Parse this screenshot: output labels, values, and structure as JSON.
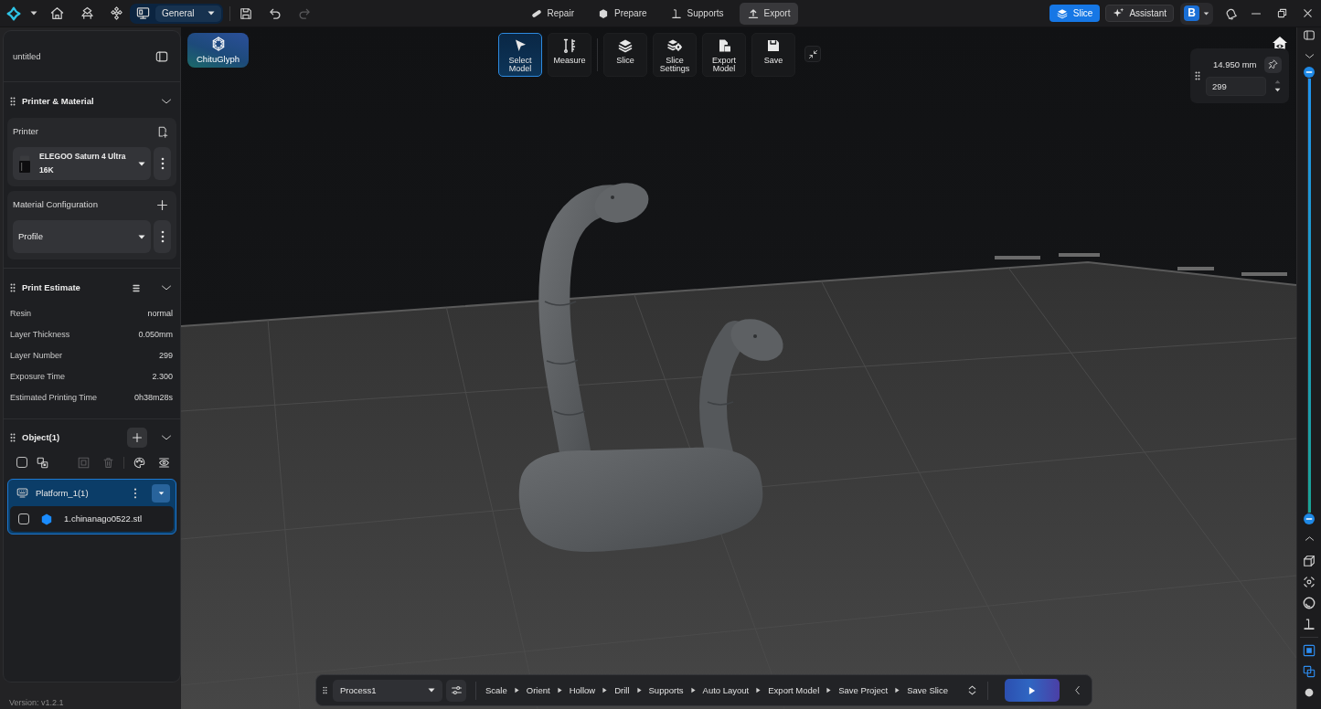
{
  "top_bar": {
    "workspace": "General",
    "history": [
      {
        "kind": "undo",
        "disabled": false
      },
      {
        "kind": "redo",
        "disabled": true
      }
    ],
    "tabs": [
      {
        "kind": "repair",
        "label": "Repair",
        "selected": false
      },
      {
        "kind": "prepare",
        "label": "Prepare",
        "selected": false
      },
      {
        "kind": "supports",
        "label": "Supports",
        "selected": false
      },
      {
        "kind": "export",
        "label": "Export",
        "selected": true
      }
    ],
    "slice_button": "Slice",
    "assistant_button": "Assistant",
    "account_initial": "B"
  },
  "left_panel": {
    "file_name": "untitled",
    "printer_material": {
      "title": "Printer & Material",
      "expanded": true,
      "printer_label": "Printer",
      "printer": "ELEGOO Saturn 4 Ultra 16K",
      "material_label": "Material Configuration",
      "profile": "Profile"
    },
    "print_estimate": {
      "title": "Print Estimate",
      "expanded": true,
      "rows": [
        {
          "label": "Resin",
          "value": "normal"
        },
        {
          "label": "Layer Thickness",
          "value": "0.050mm"
        },
        {
          "label": "Layer Number",
          "value": "299"
        },
        {
          "label": "Exposure Time",
          "value": "2.300"
        },
        {
          "label": "Estimated Printing Time",
          "value": "0h38m28s"
        }
      ]
    },
    "objects": {
      "title": "Object(1)",
      "expanded": true,
      "select_all": {
        "checked": false
      },
      "tools": [
        {
          "kind": "duplicate",
          "disabled": false
        },
        {
          "kind": "frame",
          "disabled": true
        },
        {
          "kind": "delete",
          "disabled": true
        },
        {
          "kind": "palette",
          "disabled": false
        },
        {
          "kind": "visibility",
          "disabled": false
        }
      ],
      "platforms": [
        {
          "name": "Platform_1(1)",
          "selected": true,
          "expanded": true,
          "children": [
            {
              "name": "1.chinanago0522.stl",
              "checked": false
            }
          ]
        }
      ]
    },
    "version": "Version: v1.2.1"
  },
  "viewport": {
    "plugin_button": "ChituGlyph",
    "mode_tools": [
      {
        "kind": "select",
        "label": "Select Model",
        "selected": true
      },
      {
        "kind": "measure",
        "label": "Measure",
        "selected": false
      }
    ],
    "action_tools": [
      {
        "kind": "slice",
        "label": "Slice"
      },
      {
        "kind": "slice_settings",
        "label": "Slice Settings"
      },
      {
        "kind": "export_model",
        "label": "Export Model"
      },
      {
        "kind": "save",
        "label": "Save"
      }
    ],
    "layer_panel": {
      "height": "14.950 mm",
      "layer": "299"
    },
    "pipeline": {
      "process": "Process1",
      "steps": [
        "Scale",
        "Orient",
        "Hollow",
        "Drill",
        "Supports",
        "Auto Layout",
        "Export Model",
        "Save Project",
        "Save Slice"
      ]
    }
  },
  "side_bar": {
    "layer_slider": {
      "thumbs": [
        {
          "level": 1
        },
        {
          "level": 0
        }
      ]
    },
    "view_tools": [
      {
        "kind": "views",
        "on": false
      },
      {
        "kind": "center",
        "on": false
      },
      {
        "kind": "sphere",
        "on": false
      },
      {
        "kind": "support",
        "on": false
      }
    ],
    "display_tools": [
      {
        "kind": "outline",
        "on": true
      },
      {
        "kind": "overlap",
        "on": true
      },
      {
        "kind": "dot",
        "on": false
      }
    ]
  }
}
